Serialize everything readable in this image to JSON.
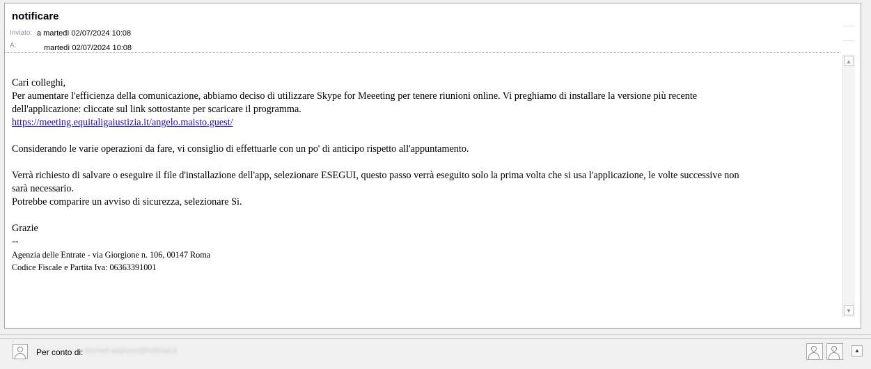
{
  "message": {
    "subject": "notificare",
    "sent_label": "Inviato:",
    "sent_value": "a martedì 02/07/2024 10:08",
    "to_label": "A:",
    "to_value": "martedì 02/07/2024 10:08"
  },
  "body": {
    "greeting": "Cari colleghi,",
    "para1_line1": "Per aumentare l'efficienza della comunicazione, abbiamo deciso di utilizzare Skype for Meeeting per tenere riunioni online. Vi preghiamo di installare la versione più recente",
    "para1_line2": "dell'applicazione: cliccate sul link sottostante per scaricare il programma.",
    "link": "https://meeting.equitaligaiustizia.it/angelo.maisto.guest/",
    "para2": "Considerando le varie operazioni da fare, vi consiglio di effettuarle con un po' di anticipo rispetto all'appuntamento.",
    "para3_line1": "Verrà richiesto di salvare o eseguire il file d'installazione dell'app, selezionare ESEGUI, questo passo verrà eseguito solo la prima volta che si usa l'applicazione, le volte successive non",
    "para3_line2": "sarà necessario.",
    "para3_line3": "Potrebbe comparire un avviso di sicurezza, selezionare Si.",
    "closing": "Grazie",
    "sig_sep": "--",
    "sig_line1": "Agenzia delle Entrate - via Giorgione n. 106, 00147 Roma",
    "sig_line2": "Codice Fiscale e Partita Iva: 06363391001"
  },
  "footer": {
    "on_behalf_label": "Per conto di:",
    "on_behalf_value": "blurred-address@hotmail.it"
  },
  "scroll": {
    "up_glyph": "▲",
    "down_glyph": "▼"
  },
  "icons": {
    "avatar": "person-icon",
    "collapse": "chevron-up-icon"
  }
}
